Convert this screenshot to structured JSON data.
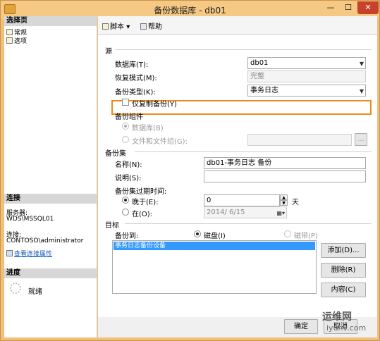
{
  "window": {
    "title": "备份数据库 - db01",
    "minimize": "—",
    "maximize": "☐",
    "close": "✕"
  },
  "sidebar": {
    "select_page_header": "选择页",
    "pages": [
      {
        "label": "常规"
      },
      {
        "label": "选项"
      }
    ],
    "connection_header": "连接",
    "server_label": "服务器:",
    "server_value": "WDS\\MSSQL01",
    "connection_label": "连接:",
    "connection_value": "CONTOSO\\administrator",
    "view_connection_link": "查看连接属性",
    "progress_header": "进度",
    "progress_status": "就绪"
  },
  "toolbar": {
    "script_label": "脚本",
    "help_label": "帮助"
  },
  "source": {
    "section_label": "源",
    "database_label": "数据库(T):",
    "database_value": "db01",
    "recovery_label": "恢复模式(M):",
    "recovery_value": "完整",
    "backup_type_label": "备份类型(K):",
    "backup_type_value": "事务日志",
    "copy_only_label": "仅复制备份(Y)",
    "component_label": "备份组件",
    "component_database": "数据库(B)",
    "component_files": "文件和文件组(G):",
    "files_button": "..."
  },
  "backup_set": {
    "section_label": "备份集",
    "name_label": "名称(N):",
    "name_value": "db01-事务日志  备份",
    "description_label": "说明(S):",
    "description_value": "",
    "expire_label": "备份集过期时间:",
    "after_label": "晚于(E):",
    "after_value": "0",
    "days_label": "天",
    "on_label": "在(O):",
    "on_value": "2014/ 6/15"
  },
  "destination": {
    "section_label": "目标",
    "backup_to_label": "备份到:",
    "disk_label": "磁盘(I)",
    "tape_label": "磁带(P)",
    "list_items": [
      "事务日志备份设备"
    ],
    "add_button": "添加(D)...",
    "remove_button": "删除(R)",
    "contents_button": "内容(C)"
  },
  "footer": {
    "ok_button": "确定",
    "cancel_button": "取消"
  },
  "watermark": {
    "line1": "运维网",
    "line2": "iyunv.com"
  },
  "colors": {
    "title_bar": "#f5c983",
    "highlight": "#ee8a1b",
    "selection": "#3399ff",
    "close": "#c7412b"
  }
}
